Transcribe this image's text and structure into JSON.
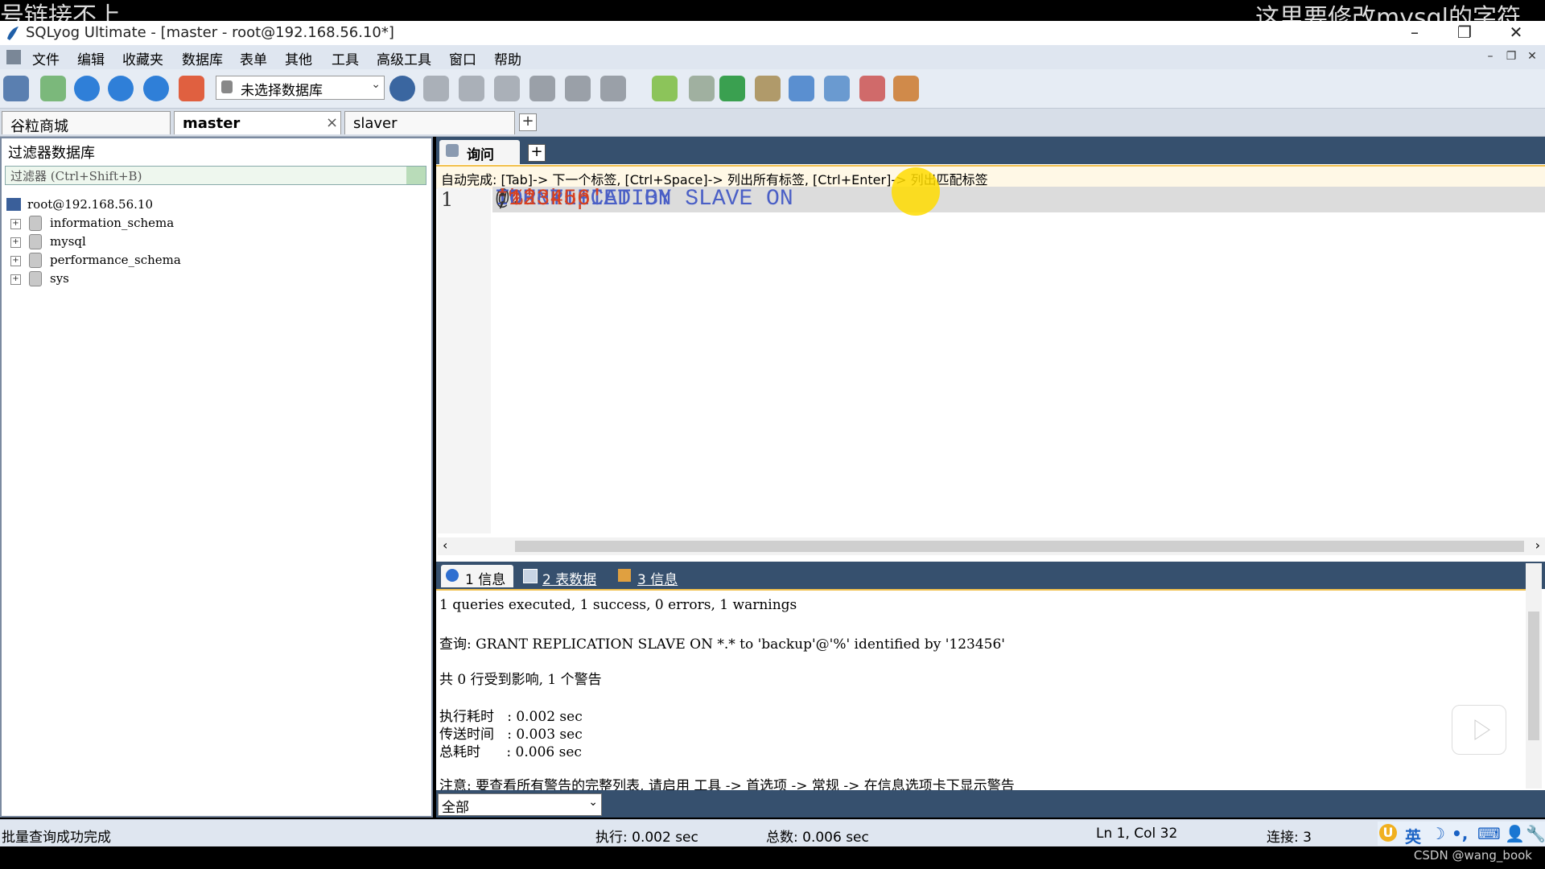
{
  "overlay": {
    "left_text": "号链接不上",
    "right_text": "这里要修改mysql的字符"
  },
  "window": {
    "title": "SQLyog Ultimate - [master - root@192.168.56.10*]"
  },
  "menu": [
    "文件",
    "编辑",
    "收藏夹",
    "数据库",
    "表单",
    "其他",
    "工具",
    "高级工具",
    "窗口",
    "帮助"
  ],
  "toolbar": {
    "db_select": "未选择数据库"
  },
  "connections": {
    "tabs": [
      "谷粒商城",
      "master",
      "slaver"
    ],
    "active": "master",
    "close": "×",
    "add": "+"
  },
  "left": {
    "filter_title": "过滤器数据库",
    "filter_placeholder": "过滤器 (Ctrl+Shift+B)",
    "root": "root@192.168.56.10",
    "databases": [
      "information_schema",
      "mysql",
      "performance_schema",
      "sys"
    ]
  },
  "query": {
    "tab_label": "询问",
    "hint": "自动完成: [Tab]-> 下一个标签, [Ctrl+Space]-> 列出所有标签, [Ctrl+Enter]-> 列出匹配标签",
    "line_number": "1",
    "code": {
      "t1": "T REPLICATION SLAVE ON ",
      "t2": "*.",
      "t3": "*",
      "t4": " TO ",
      "t5": "'backup'",
      "t6": "@",
      "t7": "'%'",
      "t8": " IDENTIFIED BY ",
      "t9": "'123456'",
      "t10": ";"
    }
  },
  "results": {
    "tabs": [
      "1 信息",
      "2 表数据",
      "3 信息"
    ],
    "lines": [
      "1 queries executed, 1 success, 0 errors, 1 warnings",
      "查询: GRANT REPLICATION SLAVE ON *.* to 'backup'@'%' identified by '123456'",
      "共 0 行受到影响, 1 个警告",
      "执行耗时   : 0.002 sec",
      "传送时间   : 0.003 sec",
      "总耗时      : 0.006 sec",
      "注意: 要查看所有警告的完整列表, 请启用 工具 -> 首选项 -> 常规 -> 在信息选项卡下显示警告"
    ],
    "filter": "全部"
  },
  "status": {
    "message": "批量查询成功完成",
    "exec": "执行: 0.002 sec",
    "total": "总数: 0.006 sec",
    "position": "Ln 1, Col 32",
    "connections": "连接: 3"
  },
  "watermark": "CSDN @wang_book",
  "ime": {
    "lang": "英"
  }
}
